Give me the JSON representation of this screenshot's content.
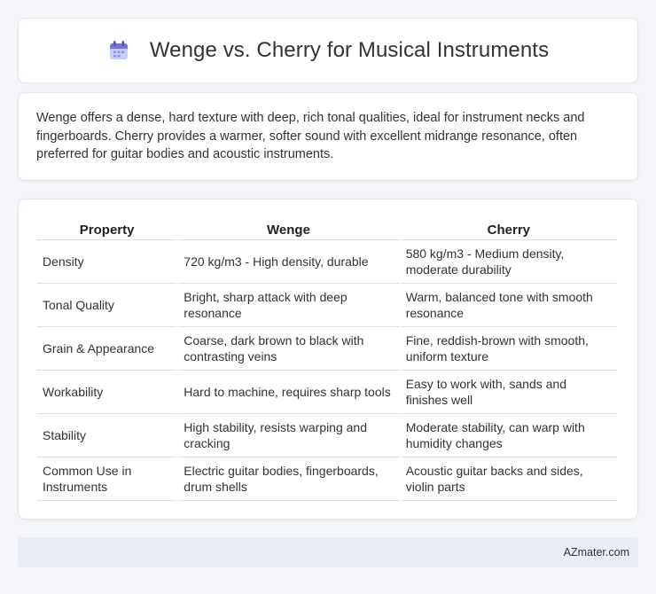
{
  "header": {
    "title": "Wenge vs. Cherry for Musical Instruments",
    "icon": "calendar-icon"
  },
  "intro": {
    "text": "Wenge offers a dense, hard texture with deep, rich tonal qualities, ideal for instrument necks and fingerboards. Cherry provides a warmer, softer sound with excellent midrange resonance, often preferred for guitar bodies and acoustic instruments."
  },
  "table": {
    "headers": [
      "Property",
      "Wenge",
      "Cherry"
    ],
    "rows": [
      [
        "Density",
        "720 kg/m3 - High density, durable",
        "580 kg/m3 - Medium density, moderate durability"
      ],
      [
        "Tonal Quality",
        "Bright, sharp attack with deep resonance",
        "Warm, balanced tone with smooth resonance"
      ],
      [
        "Grain & Appearance",
        "Coarse, dark brown to black with contrasting veins",
        "Fine, reddish-brown with smooth, uniform texture"
      ],
      [
        "Workability",
        "Hard to machine, requires sharp tools",
        "Easy to work with, sands and finishes well"
      ],
      [
        "Stability",
        "High stability, resists warping and cracking",
        "Moderate stability, can warp with humidity changes"
      ],
      [
        "Common Use in Instruments",
        "Electric guitar bodies, fingerboards, drum shells",
        "Acoustic guitar backs and sides, violin parts"
      ]
    ]
  },
  "footer": {
    "text": "AZmater.com"
  },
  "colors": {
    "background": "#f4f6fa",
    "card": "#ffffff",
    "footer_bg": "#e8edf6",
    "icon_accent": "#7b7fe0"
  }
}
